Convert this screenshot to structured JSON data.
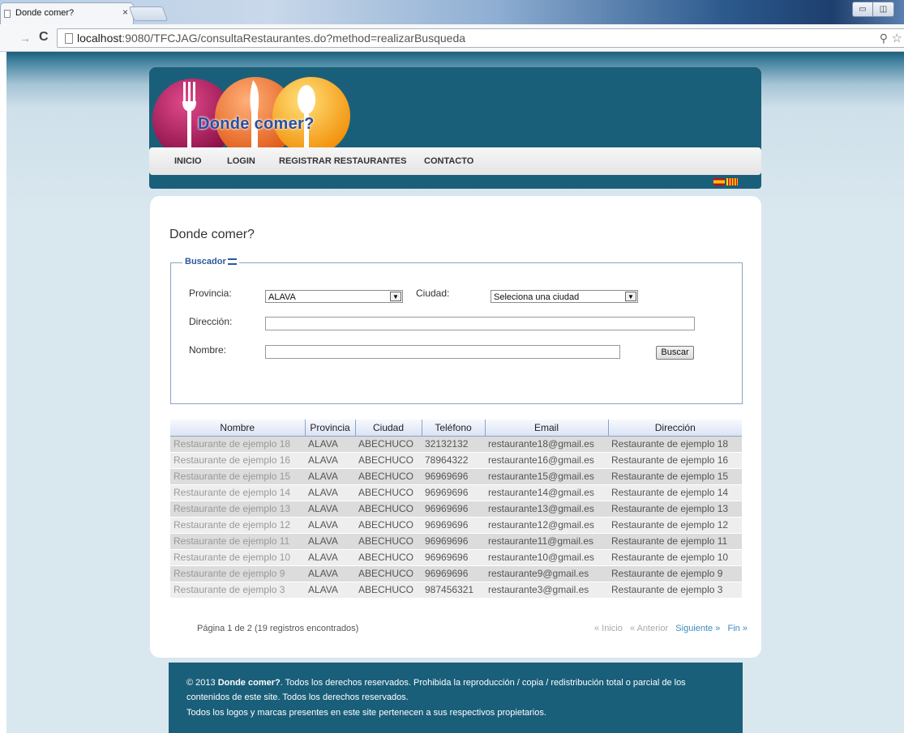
{
  "browser": {
    "tab_title": "Donde comer?",
    "tab_close": "×",
    "url_host": "localhost",
    "url_path": ":9080/TFCJAG/consultaRestaurantes.do?method=realizarBusqueda"
  },
  "header": {
    "logo_text": "Donde comer?"
  },
  "menu": {
    "items": [
      "INICIO",
      "LOGIN",
      "REGISTRAR RESTAURANTES",
      "CONTACTO"
    ]
  },
  "page": {
    "title": "Donde comer?"
  },
  "search": {
    "legend": "Buscador",
    "provincia_label": "Provincia:",
    "provincia_value": "ALAVA",
    "ciudad_label": "Ciudad:",
    "ciudad_value": "Seleciona una ciudad",
    "direccion_label": "Dirección:",
    "nombre_label": "Nombre:",
    "buscar_button": "Buscar"
  },
  "results": {
    "columns": [
      "Nombre",
      "Provincia",
      "Ciudad",
      "Teléfono",
      "Email",
      "Dirección"
    ],
    "rows": [
      [
        "Restaurante de ejemplo 18",
        "ALAVA",
        "ABECHUCO",
        "32132132",
        "restaurante18@gmail.es",
        "Restaurante de ejemplo 18"
      ],
      [
        "Restaurante de ejemplo 16",
        "ALAVA",
        "ABECHUCO",
        "78964322",
        "restaurante16@gmail.es",
        "Restaurante de ejemplo 16"
      ],
      [
        "Restaurante de ejemplo 15",
        "ALAVA",
        "ABECHUCO",
        "96969696",
        "restaurante15@gmail.es",
        "Restaurante de ejemplo 15"
      ],
      [
        "Restaurante de ejemplo 14",
        "ALAVA",
        "ABECHUCO",
        "96969696",
        "restaurante14@gmail.es",
        "Restaurante de ejemplo 14"
      ],
      [
        "Restaurante de ejemplo 13",
        "ALAVA",
        "ABECHUCO",
        "96969696",
        "restaurante13@gmail.es",
        "Restaurante de ejemplo 13"
      ],
      [
        "Restaurante de ejemplo 12",
        "ALAVA",
        "ABECHUCO",
        "96969696",
        "restaurante12@gmail.es",
        "Restaurante de ejemplo 12"
      ],
      [
        "Restaurante de ejemplo 11",
        "ALAVA",
        "ABECHUCO",
        "96969696",
        "restaurante11@gmail.es",
        "Restaurante de ejemplo 11"
      ],
      [
        "Restaurante de ejemplo 10",
        "ALAVA",
        "ABECHUCO",
        "96969696",
        "restaurante10@gmail.es",
        "Restaurante de ejemplo 10"
      ],
      [
        "Restaurante de ejemplo 9",
        "ALAVA",
        "ABECHUCO",
        "96969696",
        "restaurante9@gmail.es",
        "Restaurante de ejemplo 9"
      ],
      [
        "Restaurante de ejemplo 3",
        "ALAVA",
        "ABECHUCO",
        "987456321",
        "restaurante3@gmail.es",
        "Restaurante de ejemplo 3"
      ]
    ]
  },
  "pagination": {
    "info": "Página 1 de 2 (19 registros encontrados)",
    "inicio": "« Inicio",
    "anterior": "« Anterior",
    "siguiente": "Siguiente »",
    "fin": "Fin »"
  },
  "footer": {
    "line1_prefix": "© 2013 ",
    "line1_brand": "Donde comer?",
    "line1_rest": ". Todos los derechos reservados. Prohibida la reproducción / copia / redistribución total o parcial de los",
    "line2": "contenidos de este site. Todos los derechos reservados.",
    "line3": "Todos los logos y marcas presentes en este site pertenecen a sus respectivos propietarios."
  },
  "colors": {
    "header_bg": "#1a5f7a",
    "link": "#3d8bbd",
    "legend": "#2a5b9b"
  }
}
